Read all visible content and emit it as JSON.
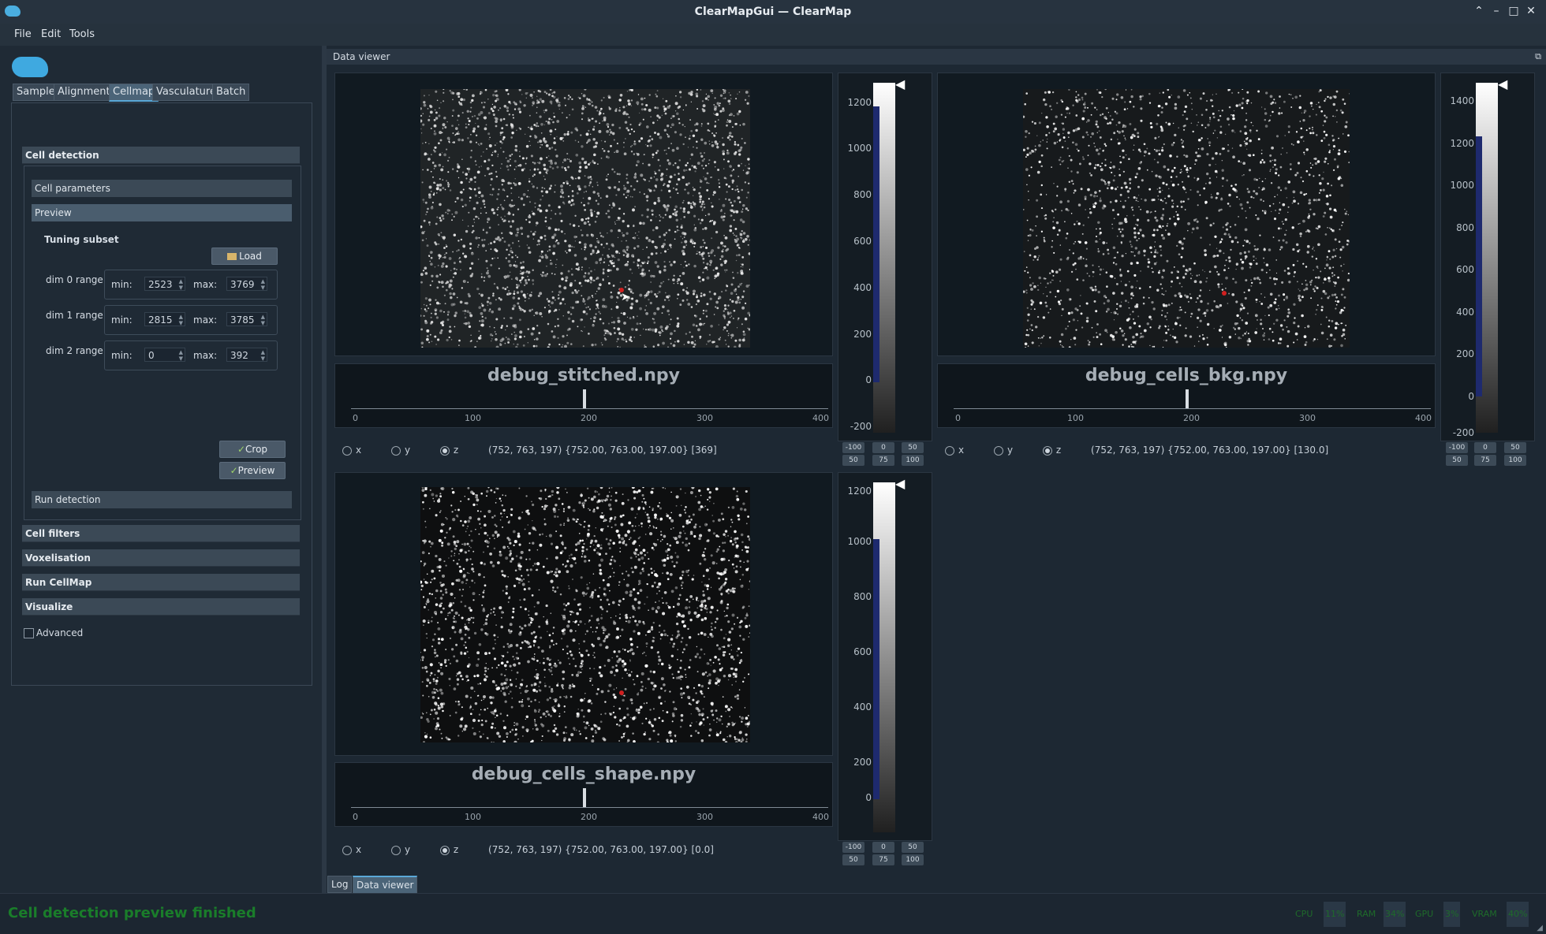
{
  "window": {
    "title": "ClearMapGui — ClearMap",
    "controls": [
      "⌃",
      "–",
      "□",
      "✕"
    ]
  },
  "menu": [
    "File",
    "Edit",
    "Tools"
  ],
  "tabs": [
    {
      "label": "Sample",
      "active": false
    },
    {
      "label": "Alignment",
      "active": false
    },
    {
      "label": "Cellmap",
      "active": true
    },
    {
      "label": "Vasculature",
      "active": false
    },
    {
      "label": "Batch",
      "active": false
    }
  ],
  "panel": {
    "cell_detection": "Cell detection",
    "cell_parameters": "Cell parameters",
    "preview": "Preview",
    "tuning_subset": "Tuning subset",
    "load_button": "Load",
    "ranges": [
      {
        "label": "dim 0 range",
        "min_label": "min:",
        "min": "2523",
        "max_label": "max:",
        "max": "3769"
      },
      {
        "label": "dim 1 range",
        "min_label": "min:",
        "min": "2815",
        "max_label": "max:",
        "max": "3785"
      },
      {
        "label": "dim 2 range",
        "min_label": "min:",
        "min": "0",
        "max_label": "max:",
        "max": "392"
      }
    ],
    "crop_button": "Crop",
    "preview_button": "Preview",
    "run_detection": "Run detection",
    "cell_filters": "Cell filters",
    "voxelisation": "Voxelisation",
    "run_cellmap": "Run CellMap",
    "visualize": "Visualize",
    "advanced": "Advanced"
  },
  "dock": {
    "title": "Data viewer"
  },
  "viewers": [
    {
      "name": "debug_stitched.npy",
      "hist_ticks": [
        "0",
        "100",
        "200",
        "300",
        "400"
      ],
      "axes": [
        "x",
        "y",
        "z"
      ],
      "selected_axis": "z",
      "coords": "(752, 763, 197) {752.00, 763.00, 197.00} [369]",
      "lut_ticks": [
        "1200",
        "1000",
        "800",
        "600",
        "400",
        "200",
        "0",
        "-200"
      ],
      "lut_buttons_top": [
        "-100",
        "0",
        "50"
      ],
      "lut_buttons_bottom": [
        "50",
        "75",
        "100"
      ]
    },
    {
      "name": "debug_cells_bkg.npy",
      "hist_ticks": [
        "0",
        "100",
        "200",
        "300",
        "400"
      ],
      "axes": [
        "x",
        "y",
        "z"
      ],
      "selected_axis": "z",
      "coords": "(752, 763, 197) {752.00, 763.00, 197.00} [130.0]",
      "lut_ticks": [
        "1400",
        "1200",
        "1000",
        "800",
        "600",
        "400",
        "200",
        "0",
        "-200"
      ],
      "lut_buttons_top": [
        "-100",
        "0",
        "50"
      ],
      "lut_buttons_bottom": [
        "50",
        "75",
        "100"
      ]
    },
    {
      "name": "debug_cells_shape.npy",
      "hist_ticks": [
        "0",
        "100",
        "200",
        "300",
        "400"
      ],
      "axes": [
        "x",
        "y",
        "z"
      ],
      "selected_axis": "z",
      "coords": "(752, 763, 197) {752.00, 763.00, 197.00} [0.0]",
      "lut_ticks": [
        "1200",
        "1000",
        "800",
        "600",
        "400",
        "200",
        "0"
      ],
      "lut_buttons_top": [
        "-100",
        "0",
        "50"
      ],
      "lut_buttons_bottom": [
        "50",
        "75",
        "100"
      ]
    }
  ],
  "bottom_tabs": [
    {
      "label": "Log",
      "active": false
    },
    {
      "label": "Data viewer",
      "active": true
    }
  ],
  "status": {
    "message": "Cell detection preview finished"
  },
  "meters": [
    {
      "label": "CPU",
      "value": "11%"
    },
    {
      "label": "RAM",
      "value": "34%"
    },
    {
      "label": "GPU",
      "value": "3%"
    },
    {
      "label": "VRAM",
      "value": "40%"
    }
  ],
  "colors": {
    "accent": "#5aa8d8",
    "status": "#1a7d2a",
    "lut_blue": "#1e2a6e"
  }
}
